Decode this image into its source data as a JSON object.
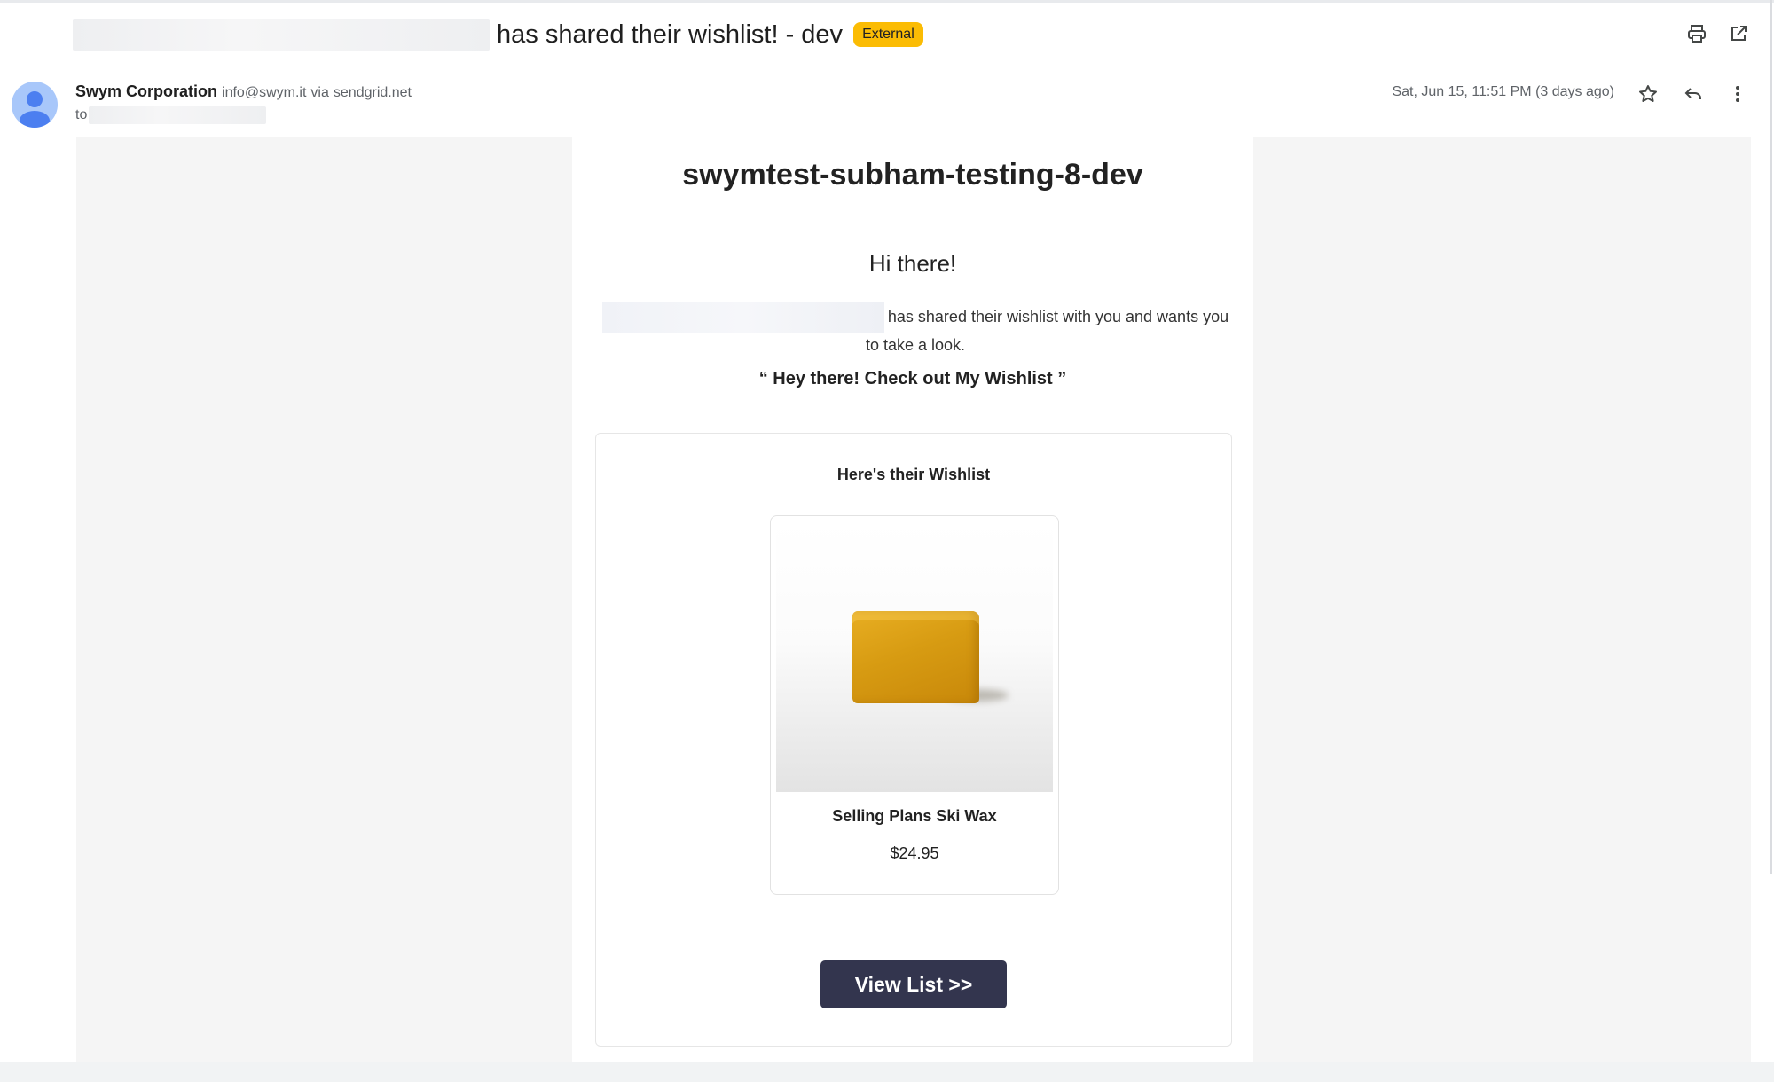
{
  "subject": {
    "text": "has shared their wishlist! - dev",
    "badge": "External"
  },
  "header_icons": [
    "print-icon",
    "open-in-new-window-icon",
    "star-icon",
    "reply-icon",
    "more-vert-icon"
  ],
  "sender": {
    "name": "Swym Corporation",
    "email": "info@swym.it",
    "via_label": "via",
    "via_domain": "sendgrid.net",
    "to_label": "to"
  },
  "date": "Sat, Jun 15, 11:51 PM (3 days ago)",
  "email": {
    "shop_name": "swymtest-subham-testing-8-dev",
    "greeting": "Hi there!",
    "share_message": "has shared their wishlist with you and wants you to take a look.",
    "quote": "“ Hey there! Check out My Wishlist ”",
    "wishlist_heading": "Here's their Wishlist",
    "product": {
      "name": "Selling Plans Ski Wax",
      "price": "$24.95"
    },
    "cta_label": "View List >>"
  },
  "colors": {
    "badge": "#fbbc04",
    "cta": "#33354e",
    "avatar": "#a8c7fa",
    "avatar_figure": "#4c7ff0",
    "wax": "#d99e14"
  }
}
